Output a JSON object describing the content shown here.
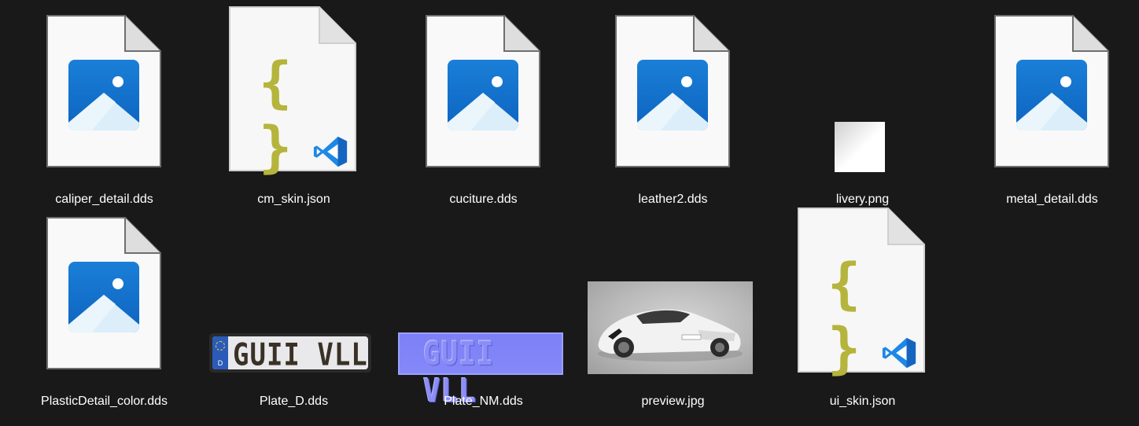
{
  "files": [
    {
      "name": "caliper_detail.dds",
      "icon": "image-file-icon"
    },
    {
      "name": "cm_skin.json",
      "icon": "json-file-icon"
    },
    {
      "name": "cuciture.dds",
      "icon": "image-file-icon"
    },
    {
      "name": "leather2.dds",
      "icon": "image-file-icon"
    },
    {
      "name": "livery.png",
      "icon": "image-thumbnail"
    },
    {
      "name": "metal_detail.dds",
      "icon": "image-file-icon"
    },
    {
      "name": "PlasticDetail_color.dds",
      "icon": "image-file-icon"
    },
    {
      "name": "Plate_D.dds",
      "icon": "plate-thumbnail",
      "plate_text": "GUII VLL",
      "country_code": "D"
    },
    {
      "name": "Plate_NM.dds",
      "icon": "normal-map-thumbnail",
      "plate_text": "GUII VLL"
    },
    {
      "name": "preview.jpg",
      "icon": "car-photo-thumbnail"
    },
    {
      "name": "ui_skin.json",
      "icon": "json-file-icon"
    }
  ],
  "json_glyph": "{ }",
  "colors": {
    "background": "#191919",
    "image_icon_blue": "#0d63c0",
    "json_brace": "#b5b43c",
    "vscode_blue": "#1e88e5",
    "normal_map": "#8084f7"
  }
}
